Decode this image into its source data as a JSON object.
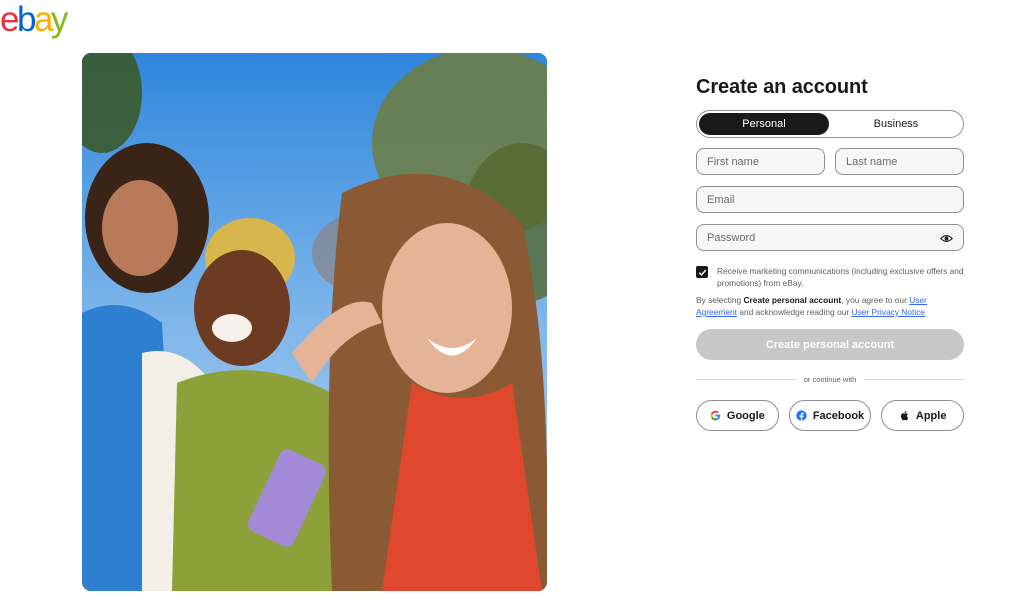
{
  "logo": {
    "letters": [
      "e",
      "b",
      "a",
      "y"
    ],
    "colors": [
      "#e53238",
      "#0064d2",
      "#f5af02",
      "#86b817"
    ]
  },
  "hero": {
    "description_icon": "photo-of-friends"
  },
  "form": {
    "title": "Create an account",
    "account_types": [
      "Personal",
      "Business"
    ],
    "selected_account_type": "Personal",
    "first_name_placeholder": "First name",
    "last_name_placeholder": "Last name",
    "email_placeholder": "Email",
    "password_placeholder": "Password",
    "marketing_label": "Receive marketing communications (including exclusive offers and promotions) from eBay.",
    "marketing_checked": true,
    "legal": {
      "prefix": "By selecting ",
      "button_name": "Create personal account",
      "middle": ", you agree to our ",
      "user_agreement": "User Agreement",
      "and": " and acknowledge reading our ",
      "privacy_notice": "User Privacy Notice"
    },
    "create_button": "Create personal account",
    "divider_text": "or continue with",
    "social": [
      {
        "label": "Google",
        "icon": "google-icon"
      },
      {
        "label": "Facebook",
        "icon": "facebook-icon"
      },
      {
        "label": "Apple",
        "icon": "apple-icon"
      }
    ]
  },
  "colors": {
    "toggle_active": "#191919",
    "button_disabled": "#c7c7c7",
    "link": "#3665f3"
  }
}
